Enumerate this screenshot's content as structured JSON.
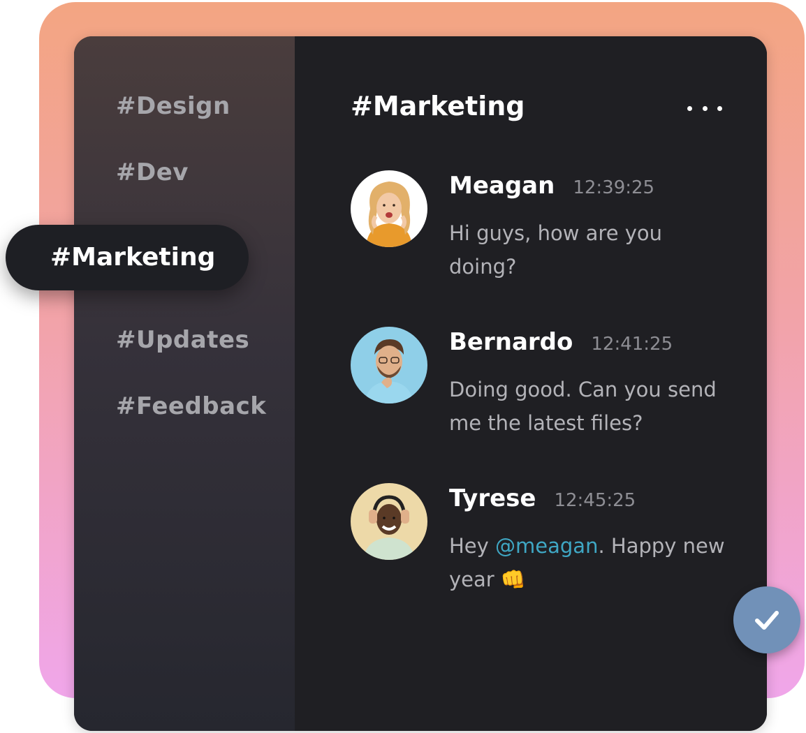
{
  "sidebar": {
    "channels": [
      {
        "label": "#Design"
      },
      {
        "label": "#Dev"
      },
      {
        "label": "#Marketing",
        "active": true
      },
      {
        "label": "#Updates"
      },
      {
        "label": "#Feedback"
      }
    ]
  },
  "main": {
    "title": "#Marketing",
    "more_icon": "more-horizontal-icon",
    "messages": [
      {
        "name": "Meagan",
        "time": "12:39:25",
        "text": "Hi guys, how are you doing?"
      },
      {
        "name": "Bernardo",
        "time": "12:41:25",
        "text": "Doing good. Can you send me the latest files?"
      },
      {
        "name": "Tyrese",
        "time": "12:45:25",
        "text_before": "Hey ",
        "mention": "@meagan",
        "text_after": ". Happy new year ",
        "emoji": "👊"
      }
    ]
  },
  "check_button": {
    "icon": "check-icon"
  },
  "colors": {
    "background_gradient": [
      "#f3a582",
      "#f0a6ea"
    ],
    "sidebar": "#35313a",
    "main": "#1f1f23",
    "mention": "#3fa7c4",
    "check_button": "#7191b8"
  }
}
